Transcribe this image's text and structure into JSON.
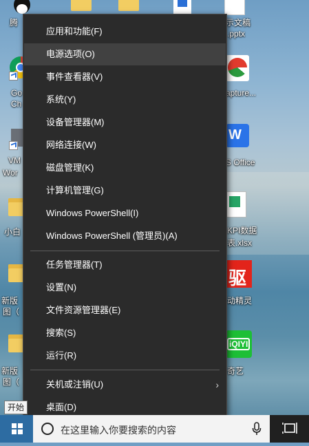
{
  "desktop": {
    "labels": {
      "qq": "腾",
      "chrome_1": "Go",
      "chrome_2": "Ch",
      "vm_1": "VM",
      "vm_2": "Wor",
      "xiaobai": "小白",
      "newfile1_1": "新版",
      "newfile1_2": "图（",
      "newfile2_1": "新版",
      "newfile2_2": "图（",
      "pptx_1": "示文稿",
      "pptx_2": ".pptx",
      "capture": "apture...",
      "wps": "S Office",
      "kpi_1": "KPI数据",
      "kpi_2": "表.xlsx",
      "driver": "动精灵",
      "iqiyi": "奇艺"
    },
    "driver_icon_text": "驱",
    "iqiyi_icon_text": "iQIYI"
  },
  "menu": {
    "items": [
      {
        "label": "应用和功能(F)"
      },
      {
        "label": "电源选项(O)"
      },
      {
        "label": "事件查看器(V)"
      },
      {
        "label": "系统(Y)"
      },
      {
        "label": "设备管理器(M)"
      },
      {
        "label": "网络连接(W)"
      },
      {
        "label": "磁盘管理(K)"
      },
      {
        "label": "计算机管理(G)"
      },
      {
        "label": "Windows PowerShell(I)"
      },
      {
        "label": "Windows PowerShell (管理员)(A)"
      },
      {
        "label": "任务管理器(T)"
      },
      {
        "label": "设置(N)"
      },
      {
        "label": "文件资源管理器(E)"
      },
      {
        "label": "搜索(S)"
      },
      {
        "label": "运行(R)"
      },
      {
        "label": "关机或注销(U)"
      },
      {
        "label": "桌面(D)"
      }
    ],
    "submenu_arrow": "›"
  },
  "tooltip": "开始",
  "taskbar": {
    "search_placeholder": "在这里输入你要搜索的内容"
  },
  "colors": {
    "menu_bg": "#2b2b2b",
    "menu_highlight": "#414141",
    "start_button": "#2d6ca2"
  }
}
